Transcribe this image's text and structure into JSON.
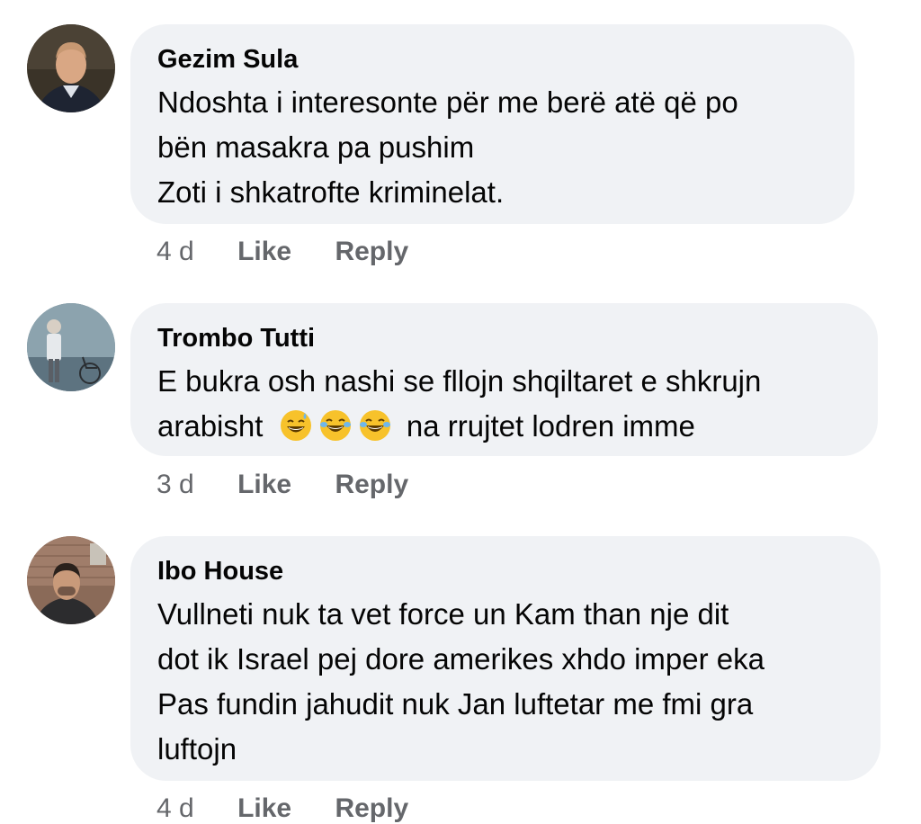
{
  "comments": [
    {
      "author": "Gezim Sula",
      "lines": [
        "Ndoshta i interesonte për me berë atë që po",
        "bën masakra pa pushim",
        "Zoti i shkatrofte kriminelat."
      ],
      "time": "4 d",
      "like_label": "Like",
      "reply_label": "Reply"
    },
    {
      "author": "Trombo Tutti",
      "lines": [
        "E bukra osh nashi se fllojn shqiltaret e shkrujn"
      ],
      "line2_prefix": "arabisht",
      "emojis": [
        "sweat-smile-emoji",
        "joy-emoji",
        "joy-emoji"
      ],
      "line2_suffix": "na rrujtet lodren imme",
      "time": "3 d",
      "like_label": "Like",
      "reply_label": "Reply"
    },
    {
      "author": "Ibo House",
      "lines": [
        "Vullneti nuk ta vet force un Kam than nje dit",
        "dot ik Israel pej dore amerikes xhdo imper eka",
        "Pas fundin jahudit nuk Jan luftetar me fmi gra",
        "luftojn"
      ],
      "time": "4 d",
      "like_label": "Like",
      "reply_label": "Reply"
    }
  ],
  "colors": {
    "bubble": "#f0f2f5",
    "text": "#050505",
    "secondary": "#65676b"
  }
}
